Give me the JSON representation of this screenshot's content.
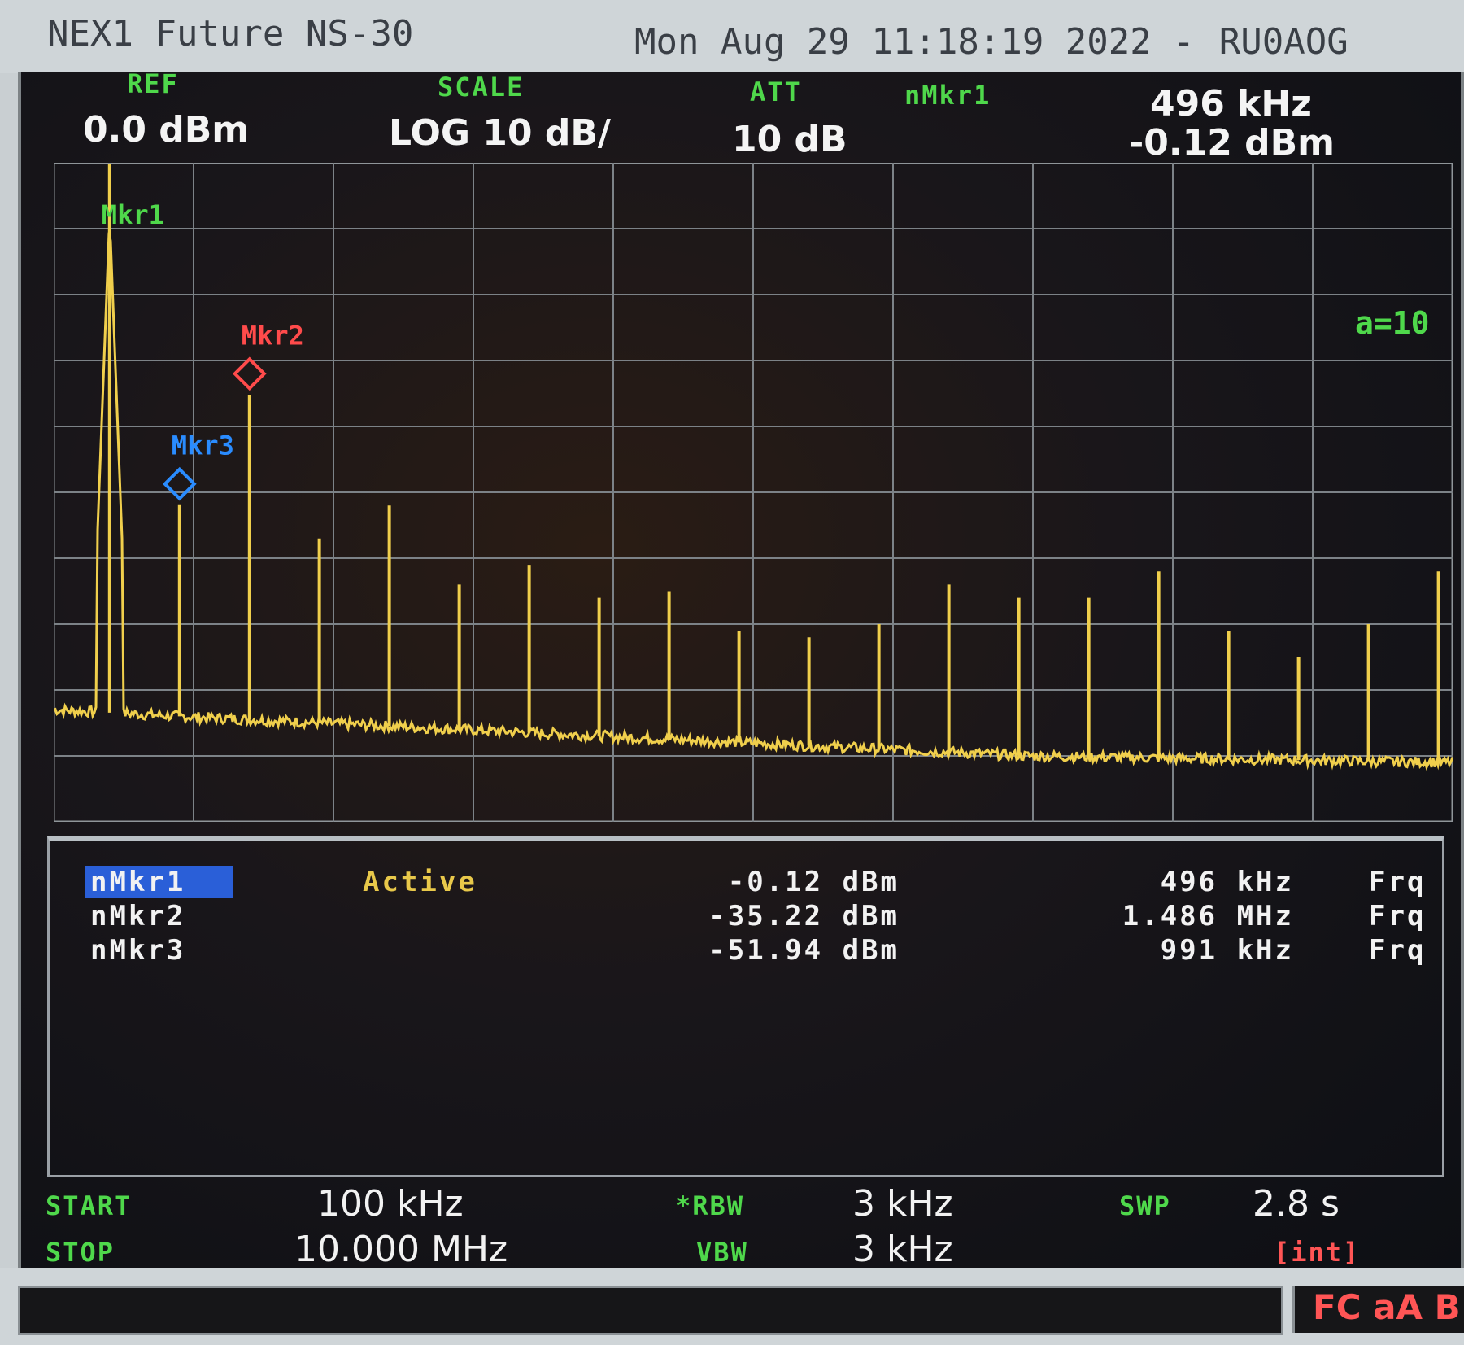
{
  "window": {
    "title": "NEX1 Future NS-30",
    "datetime": "Mon Aug 29 11:18:19 2022 -",
    "callsign": "RU0AOG"
  },
  "header": {
    "ref_label": "REF",
    "ref_value": "0.0 dBm",
    "scale_label": "SCALE",
    "scale_value": "LOG 10 dB/",
    "att_label": "ATT",
    "att_value": "10 dB",
    "marker_label": "nMkr1",
    "marker_freq": "496 kHz",
    "marker_amp": "-0.12 dBm"
  },
  "trace": {
    "avg_label": "a=10",
    "color": "#f0cf4c"
  },
  "markers": [
    {
      "name": "nMkr1",
      "state": "Active",
      "amplitude": "-0.12 dBm",
      "frequency": "496 kHz",
      "mode": "Frq",
      "tag": "Mkr1",
      "color": "#4fd84b"
    },
    {
      "name": "nMkr2",
      "state": "",
      "amplitude": "-35.22 dBm",
      "frequency": "1.486 MHz",
      "mode": "Frq",
      "tag": "Mkr2",
      "color": "#ff4b4b"
    },
    {
      "name": "nMkr3",
      "state": "",
      "amplitude": "-51.94 dBm",
      "frequency": "991 kHz",
      "mode": "Frq",
      "tag": "Mkr3",
      "color": "#2a8cff"
    }
  ],
  "footer": {
    "start_label": "START",
    "start_value": "100 kHz",
    "stop_label": "STOP",
    "stop_value": "10.000 MHz",
    "rbw_label": "*RBW",
    "rbw_value": "3 kHz",
    "vbw_label": "VBW",
    "vbw_value": "3 kHz",
    "swp_label": "SWP",
    "swp_value": "2.8 s",
    "swp_mode": "[int]"
  },
  "status": {
    "indicators": "FC aA B"
  },
  "chart_data": {
    "type": "line",
    "xlabel": "",
    "ylabel": "",
    "xlim": [
      0.1,
      10.0
    ],
    "ylim": [
      -100,
      0
    ],
    "x_unit": "MHz",
    "y_unit": "dBm",
    "grid": true,
    "series": [
      {
        "x": [
          0.496,
          0.991,
          1.486,
          1.98,
          2.475,
          2.97,
          3.465,
          3.96,
          4.455,
          4.95,
          5.445,
          5.94,
          6.435,
          6.93,
          7.425,
          7.92,
          8.415,
          8.91,
          9.405,
          9.9
        ],
        "values": [
          -0.12,
          -51.94,
          -35.22,
          -57,
          -52,
          -64,
          -61,
          -66,
          -65,
          -71,
          -72,
          -70,
          -64,
          -66,
          -66,
          -62,
          -71,
          -75,
          -70,
          -62
        ]
      }
    ],
    "noise_floor": [
      [
        0.1,
        -83
      ],
      [
        1.0,
        -84
      ],
      [
        3.0,
        -86
      ],
      [
        5.0,
        -88
      ],
      [
        7.0,
        -90
      ],
      [
        10.0,
        -91
      ]
    ]
  }
}
